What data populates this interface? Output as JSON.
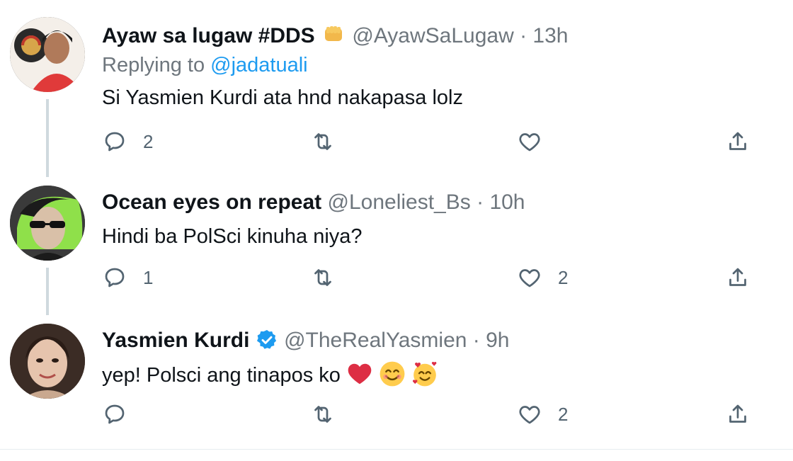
{
  "tweets": [
    {
      "name": "Ayaw sa lugaw #DDS",
      "handle": "@AyawSaLugaw",
      "dot": "·",
      "time": "13h",
      "replying_prefix": "Replying to",
      "replying_to": "@jadatuali",
      "text": "Si Yasmien Kurdi ata hnd nakapasa lolz",
      "replies": "2",
      "retweets": "",
      "likes": ""
    },
    {
      "name": "Ocean eyes on repeat",
      "handle": "@Loneliest_Bs",
      "dot": "·",
      "time": "10h",
      "text": "Hindi ba PolSci kinuha niya?",
      "replies": "1",
      "retweets": "",
      "likes": "2"
    },
    {
      "name": "Yasmien Kurdi",
      "handle": "@TheRealYasmien",
      "dot": "·",
      "time": "9h",
      "text": "yep! Polsci ang tinapos ko",
      "replies": "",
      "retweets": "",
      "likes": "2"
    }
  ],
  "colors": {
    "accent": "#1d9bf0",
    "muted": "#6e767d",
    "icon": "#536471",
    "verified": "#1d9bf0",
    "heart_emoji": "#e0245e"
  },
  "icons": {
    "reply": "reply-icon",
    "retweet": "retweet-icon",
    "like": "heart-icon",
    "share": "share-icon",
    "verified": "verified-badge-icon",
    "fist": "raised-fist-emoji-icon"
  }
}
